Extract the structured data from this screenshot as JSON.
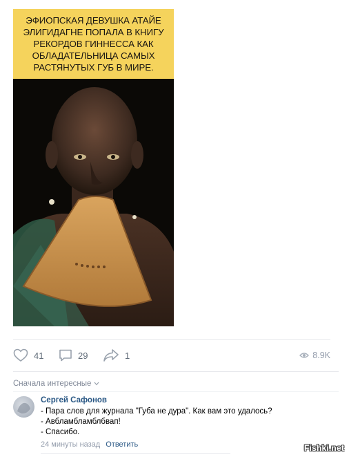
{
  "post": {
    "caption": "Эфиопская девушка Атайе Элигидагне попала в книгу рекордов Гиннесса как обладательница самых растянутых губ в мире."
  },
  "actions": {
    "likes": "41",
    "comments": "29",
    "shares": "1",
    "views": "8.9K"
  },
  "comments_section": {
    "sort_label": "Сначала интересные",
    "items": [
      {
        "author": "Сергей Сафонов",
        "lines": [
          "- Пара слов для журнала \"Губа не дура\". Как вам это удалось?",
          "- Авбламбламблбвап!",
          "- Спасибо."
        ],
        "time": "24 минуты назад",
        "reply_label": "Ответить"
      }
    ]
  },
  "watermark": "Fishki.net",
  "colors": {
    "caption_bg": "#f5d35c",
    "link": "#2a5885",
    "muted": "#939cab"
  },
  "icons": [
    "heart-icon",
    "comment-icon",
    "share-icon",
    "eye-icon",
    "chevron-down-icon"
  ]
}
